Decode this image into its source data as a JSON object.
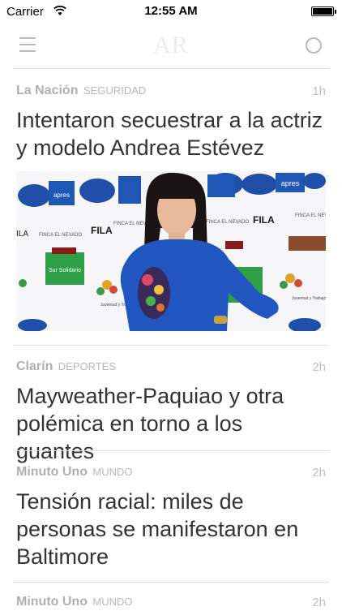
{
  "status_bar": {
    "carrier": "Carrier",
    "time": "12:55 AM"
  },
  "nav": {
    "logo": "AR",
    "menu_icon": "hamburger-menu-icon",
    "search_icon": "search-circle-icon"
  },
  "articles": [
    {
      "source": "La Nación",
      "section": "SEGURIDAD",
      "age": "1h",
      "headline": "Intentaron secuestrar a la actriz y modelo Andrea Estévez",
      "image": "photo of woman in blue sweater at press backdrop"
    },
    {
      "source": "Clarín",
      "section": "DEPORTES",
      "age": "2h",
      "headline": "Mayweather-Paquiao y otra polémica en torno a los guantes"
    },
    {
      "source": "Minuto Uno",
      "section": "MUNDO",
      "age": "2h",
      "headline": "Tensión racial: miles de personas se manifestaron en Baltimore"
    },
    {
      "source": "Minuto Uno",
      "section": "MUNDO",
      "age": "2h",
      "headline": ""
    }
  ],
  "backdrop_logos": [
    "FILA",
    "apres",
    "FINCA EL NEVADO",
    "Sur Solidario",
    "Juventud y Trabajo"
  ],
  "colors": {
    "accent_blue": "#1f57b6",
    "sweater_blue": "#2156c0",
    "meta_gray": "#b0b0b0",
    "headline": "#333333"
  }
}
